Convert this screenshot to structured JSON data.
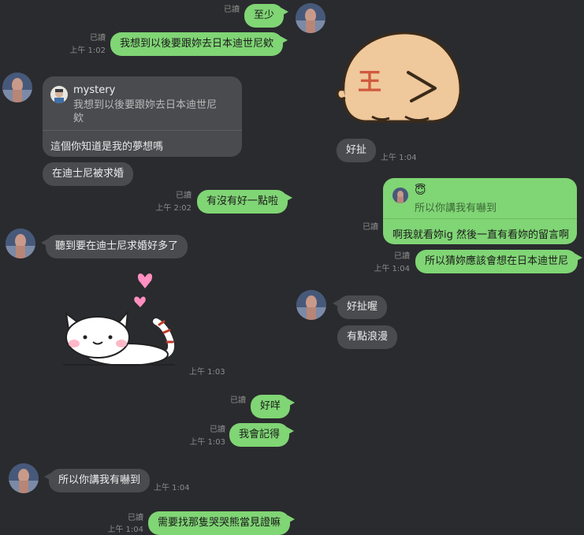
{
  "read_label": "已讀",
  "messages": {
    "m1": {
      "text": "至少"
    },
    "m2": {
      "text": "我想到以後要跟妳去日本迪世尼欸",
      "time": "上午 1:02"
    },
    "m3": {
      "quote_name": "mystery",
      "quote_line1": "我想到以後要跟妳去日本迪世尼",
      "quote_line2": "欸",
      "text": "這個你知道是我的夢想嗎"
    },
    "m4": {
      "text": "在迪士尼被求婚"
    },
    "m5": {
      "text": "有沒有好一點啦",
      "time": "上午 2:02"
    },
    "m6": {
      "text": "聽到要在迪士尼求婚好多了"
    },
    "m7": {
      "time": "上午 1:03"
    },
    "m8": {
      "text": "好咩"
    },
    "m9": {
      "text": "我會記得",
      "time": "上午 1:03"
    },
    "m10": {
      "text": "所以你講我有嚇到",
      "time": "上午 1:04"
    },
    "m11": {
      "text": "需要找那隻哭哭熊當見證嘛",
      "time": "上午 1:04"
    },
    "r1": {
      "text": "好扯",
      "time": "上午 1:04"
    },
    "r2": {
      "quote_emoji": "😇",
      "quote_text": "所以你講我有嚇到",
      "text": "啊我就看妳ig 然後一直有看妳的留言啊"
    },
    "r3": {
      "text": "所以猜妳應該會想在日本迪世尼",
      "time": "上午 1:04"
    },
    "r4": {
      "text": "好扯喔"
    },
    "r5": {
      "text": "有點浪漫"
    }
  },
  "sticker_bear": {
    "glyph": "王"
  },
  "colors": {
    "green": "#80d575",
    "grey": "#4a4b4f",
    "background": "#2a2b2e"
  }
}
